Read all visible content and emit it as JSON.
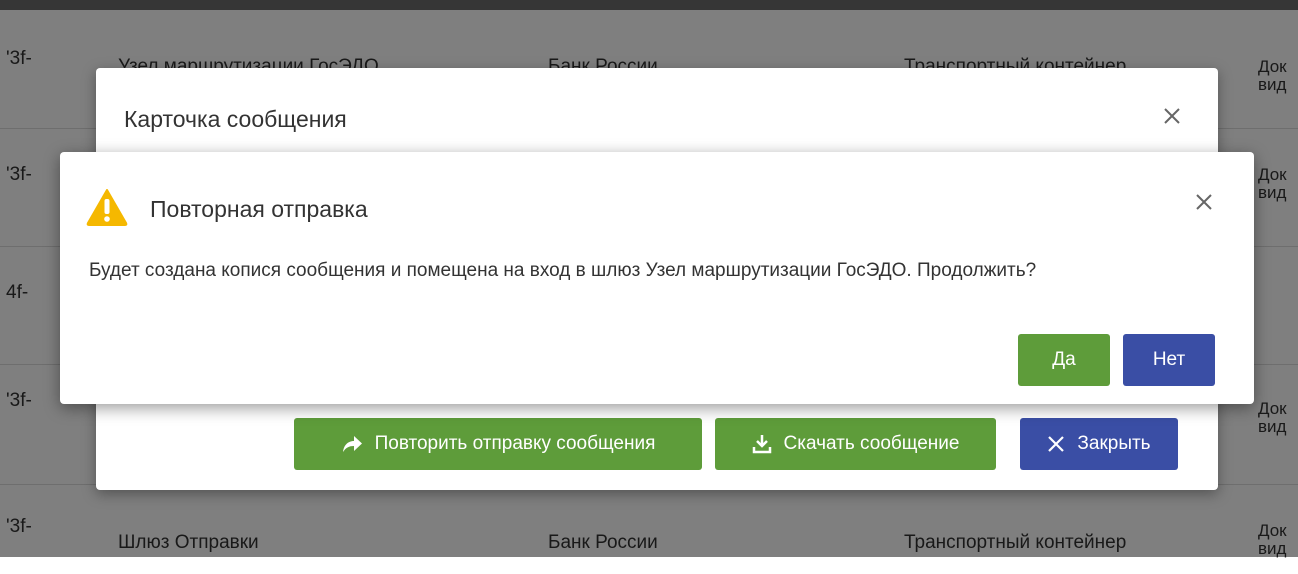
{
  "background_table": {
    "rows": [
      {
        "id": "'3f-",
        "sender": "Узел маршрутизации ГосЭДО",
        "receiver": "Банк России",
        "type": "Транспортный контейнер",
        "doc": "Док\nвид"
      },
      {
        "id": "'3f-",
        "sender": "",
        "receiver": "",
        "type": "",
        "doc": "Док\nвид"
      },
      {
        "id": "4f-",
        "sender": "",
        "receiver": "",
        "type": "",
        "doc": ""
      },
      {
        "id": "'3f-",
        "sender": "",
        "receiver": "",
        "type": "",
        "doc": "Док\nвид"
      },
      {
        "id": "'3f-",
        "sender": "Шлюз Отправки",
        "receiver": "Банк России",
        "type": "Транспортный контейнер",
        "doc": "Док\nвид"
      }
    ]
  },
  "card_modal": {
    "title": "Карточка сообщения",
    "resend_button": "Повторить отправку сообщения",
    "download_button": "Скачать сообщение",
    "close_button": "Закрыть"
  },
  "confirm_dialog": {
    "title": "Повторная отправка",
    "message": "Будет создана копися сообщения и помещена на вход в шлюз Узел маршрутизации ГосЭДО. Продолжить?",
    "yes_button": "Да",
    "no_button": "Нет"
  },
  "colors": {
    "green": "#5e9c3a",
    "blue": "#3a4ea5",
    "warning": "#f5b800"
  }
}
